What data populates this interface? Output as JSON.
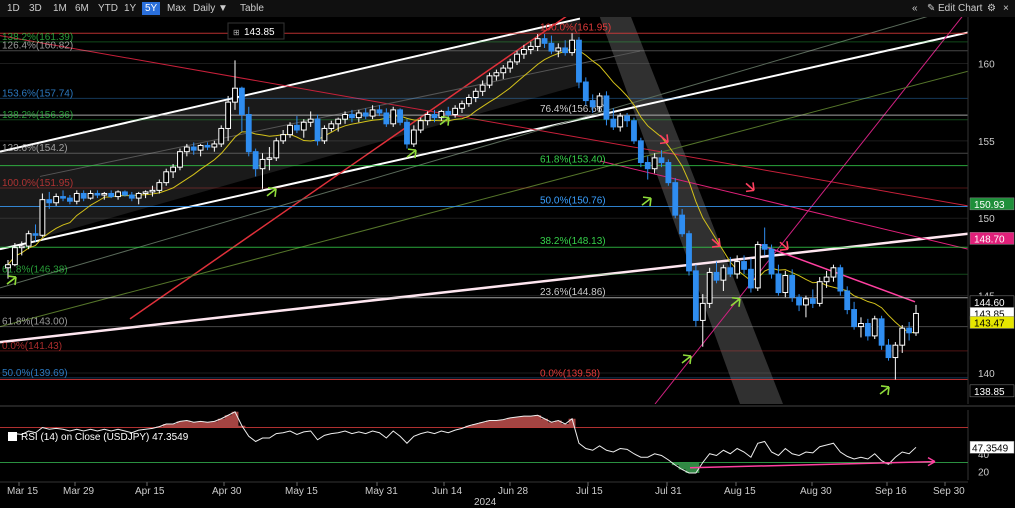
{
  "toolbar": {
    "ranges": [
      "1D",
      "3D",
      "1M",
      "6M",
      "YTD",
      "1Y",
      "5Y",
      "Max"
    ],
    "active_range": "5Y",
    "interval": "Daily ▼",
    "table_label": "Table",
    "collapse_icon": "«",
    "edit_label": "Edit Chart",
    "edit_icon": "pencil-icon",
    "gear_icon": "gear-icon"
  },
  "cursor_readout": "143.85",
  "chart_data": {
    "type": "candlestick",
    "ylim": [
      138,
      163
    ],
    "yticks": [
      140,
      145,
      150,
      155,
      160
    ],
    "x_ticks": [
      "Mar 15",
      "Mar 29",
      "Apr 15",
      "Apr 30",
      "May 15",
      "May 31",
      "Jun 14",
      "Jun 28",
      "Jul 15",
      "Jul 31",
      "Aug 15",
      "Aug 30",
      "Sep 16",
      "Sep 30"
    ],
    "x_year_label": "2024",
    "fib_levels": [
      {
        "label": "100.0%(161.95)",
        "value": 161.95,
        "color": "#e33b3b"
      },
      {
        "label": "76.4%(156.66)",
        "value": 156.66,
        "color": "#cccccc"
      },
      {
        "label": "61.8%(153.40)",
        "value": 153.4,
        "color": "#35d04a"
      },
      {
        "label": "50.0%(150.76)",
        "value": 150.76,
        "color": "#3aa0ff"
      },
      {
        "label": "38.2%(148.13)",
        "value": 148.13,
        "color": "#35d04a"
      },
      {
        "label": "23.6%(144.86)",
        "value": 144.86,
        "color": "#cccccc"
      },
      {
        "label": "0.0%(139.58)",
        "value": 139.58,
        "color": "#e33b3b"
      }
    ],
    "left_fib_labels": [
      {
        "label": "138.2%(161.39)",
        "value": 161.39,
        "color": "#35d04a"
      },
      {
        "label": "126.4%(160.82)",
        "value": 160.82,
        "color": "#cccccc"
      },
      {
        "label": "153.6%(157.74)",
        "value": 157.74,
        "color": "#3aa0ff"
      },
      {
        "label": "138.2%(156.36)",
        "value": 156.36,
        "color": "#35d04a"
      },
      {
        "label": "123.6%(154.2)",
        "value": 154.2,
        "color": "#cccccc"
      },
      {
        "label": "100.0%(151.95)",
        "value": 151.95,
        "color": "#e33b3b"
      },
      {
        "label": "61.8%(146.38)",
        "value": 146.38,
        "color": "#35d04a"
      },
      {
        "label": "61.8%(143.00)",
        "value": 143.0,
        "color": "#cccccc"
      },
      {
        "label": "0.0%(141.43)",
        "value": 141.43,
        "color": "#e33b3b"
      },
      {
        "label": "50.0%(139.69)",
        "value": 139.69,
        "color": "#3aa0ff"
      }
    ],
    "price_tags": [
      {
        "label": "150.93",
        "value": 150.93,
        "bg": "#1f8f3a",
        "fg": "#ffffff"
      },
      {
        "label": "148.70",
        "value": 148.7,
        "bg": "#e0207a",
        "fg": "#ffffff"
      },
      {
        "label": "144.60",
        "value": 144.6,
        "bg": "#000000",
        "fg": "#ffffff"
      },
      {
        "label": "143.85",
        "value": 143.85,
        "bg": "#ffffff",
        "fg": "#000000"
      },
      {
        "label": "143.47",
        "value": 143.47,
        "bg": "#e6e600",
        "fg": "#000000"
      },
      {
        "label": "138.85",
        "value": 138.85,
        "bg": "#000000",
        "fg": "#ffffff"
      }
    ],
    "candles": [
      [
        146.8,
        147.3,
        146.1,
        147.0
      ],
      [
        147.0,
        148.4,
        146.9,
        148.1
      ],
      [
        148.1,
        148.5,
        147.6,
        148.2
      ],
      [
        148.2,
        149.2,
        148.0,
        149.0
      ],
      [
        149.0,
        149.6,
        148.5,
        148.9
      ],
      [
        148.9,
        151.6,
        148.8,
        151.2
      ],
      [
        151.2,
        151.7,
        150.6,
        151.0
      ],
      [
        151.0,
        151.6,
        150.8,
        151.4
      ],
      [
        151.4,
        151.8,
        151.1,
        151.3
      ],
      [
        151.3,
        151.5,
        150.9,
        151.1
      ],
      [
        151.1,
        151.8,
        150.9,
        151.6
      ],
      [
        151.6,
        151.8,
        151.1,
        151.3
      ],
      [
        151.3,
        151.8,
        151.2,
        151.6
      ],
      [
        151.6,
        151.8,
        151.3,
        151.5
      ],
      [
        151.5,
        151.7,
        151.2,
        151.6
      ],
      [
        151.6,
        151.8,
        151.3,
        151.4
      ],
      [
        151.4,
        151.8,
        151.2,
        151.7
      ],
      [
        151.7,
        151.8,
        151.4,
        151.5
      ],
      [
        151.5,
        151.7,
        151.1,
        151.3
      ],
      [
        151.3,
        151.7,
        150.9,
        151.6
      ],
      [
        151.6,
        151.8,
        151.3,
        151.7
      ],
      [
        151.7,
        152.1,
        151.4,
        151.8
      ],
      [
        151.8,
        152.5,
        151.6,
        152.3
      ],
      [
        152.3,
        153.2,
        152.1,
        153.0
      ],
      [
        153.0,
        153.5,
        152.6,
        153.3
      ],
      [
        153.3,
        154.5,
        153.1,
        154.3
      ],
      [
        154.3,
        154.8,
        154.0,
        154.6
      ],
      [
        154.6,
        154.9,
        154.1,
        154.4
      ],
      [
        154.4,
        154.8,
        154.0,
        154.7
      ],
      [
        154.7,
        154.9,
        154.4,
        154.6
      ],
      [
        154.6,
        155.0,
        154.3,
        154.8
      ],
      [
        154.8,
        156.0,
        154.6,
        155.8
      ],
      [
        155.8,
        157.9,
        155.0,
        157.5
      ],
      [
        157.5,
        160.2,
        157.0,
        158.4
      ],
      [
        158.4,
        158.5,
        155.6,
        156.7
      ],
      [
        156.7,
        157.2,
        154.0,
        154.3
      ],
      [
        154.3,
        154.5,
        152.7,
        153.2
      ],
      [
        153.2,
        154.2,
        151.9,
        153.8
      ],
      [
        153.8,
        154.6,
        153.1,
        153.9
      ],
      [
        153.9,
        155.2,
        153.7,
        155.0
      ],
      [
        155.0,
        155.7,
        154.8,
        155.4
      ],
      [
        155.4,
        156.2,
        155.2,
        156.0
      ],
      [
        156.0,
        156.6,
        155.5,
        155.7
      ],
      [
        155.7,
        156.4,
        155.2,
        156.2
      ],
      [
        156.2,
        156.9,
        155.9,
        156.4
      ],
      [
        156.4,
        156.7,
        154.7,
        155.0
      ],
      [
        155.0,
        156.0,
        154.8,
        155.8
      ],
      [
        155.8,
        156.3,
        155.6,
        156.1
      ],
      [
        156.1,
        156.5,
        155.6,
        156.4
      ],
      [
        156.4,
        156.9,
        156.1,
        156.7
      ],
      [
        156.7,
        157.0,
        156.2,
        156.5
      ],
      [
        156.5,
        157.0,
        156.2,
        156.8
      ],
      [
        156.8,
        157.1,
        156.4,
        156.6
      ],
      [
        156.6,
        157.3,
        156.4,
        157.0
      ],
      [
        157.0,
        157.3,
        156.6,
        156.8
      ],
      [
        156.8,
        157.1,
        155.9,
        156.1
      ],
      [
        156.1,
        157.2,
        155.9,
        157.0
      ],
      [
        157.0,
        157.1,
        156.0,
        156.2
      ],
      [
        156.2,
        156.4,
        154.5,
        154.8
      ],
      [
        154.8,
        156.0,
        154.6,
        155.7
      ],
      [
        155.7,
        156.5,
        155.5,
        156.3
      ],
      [
        156.3,
        156.9,
        156.0,
        156.7
      ],
      [
        156.7,
        157.0,
        156.2,
        156.5
      ],
      [
        156.5,
        157.0,
        156.3,
        156.9
      ],
      [
        156.9,
        157.2,
        156.4,
        156.7
      ],
      [
        156.7,
        157.3,
        156.5,
        157.1
      ],
      [
        157.1,
        157.6,
        156.8,
        157.4
      ],
      [
        157.4,
        158.0,
        157.2,
        157.8
      ],
      [
        157.8,
        158.4,
        157.5,
        158.2
      ],
      [
        158.2,
        158.9,
        157.9,
        158.6
      ],
      [
        158.6,
        159.4,
        158.4,
        159.2
      ],
      [
        159.2,
        159.6,
        158.9,
        159.4
      ],
      [
        159.4,
        159.9,
        159.0,
        159.7
      ],
      [
        159.7,
        160.3,
        159.4,
        160.1
      ],
      [
        160.1,
        160.8,
        159.9,
        160.6
      ],
      [
        160.6,
        161.2,
        160.3,
        160.9
      ],
      [
        160.9,
        161.4,
        160.6,
        161.1
      ],
      [
        161.1,
        161.9,
        160.8,
        161.6
      ],
      [
        161.6,
        161.9,
        161.0,
        161.3
      ],
      [
        161.3,
        161.8,
        160.6,
        160.8
      ],
      [
        160.8,
        161.3,
        160.4,
        161.0
      ],
      [
        161.0,
        161.5,
        160.5,
        160.7
      ],
      [
        160.7,
        161.95,
        160.5,
        161.5
      ],
      [
        161.5,
        161.7,
        158.4,
        158.8
      ],
      [
        158.8,
        159.1,
        157.3,
        157.6
      ],
      [
        157.6,
        158.0,
        156.8,
        157.2
      ],
      [
        157.2,
        158.1,
        156.9,
        157.9
      ],
      [
        157.9,
        158.2,
        156.0,
        156.4
      ],
      [
        156.4,
        157.1,
        155.7,
        155.9
      ],
      [
        155.9,
        156.8,
        155.6,
        156.6
      ],
      [
        156.6,
        156.8,
        155.9,
        156.3
      ],
      [
        156.3,
        156.5,
        154.8,
        155.0
      ],
      [
        155.0,
        155.2,
        153.3,
        153.6
      ],
      [
        153.6,
        154.0,
        152.5,
        153.2
      ],
      [
        153.2,
        154.2,
        152.9,
        153.9
      ],
      [
        153.9,
        154.4,
        153.3,
        153.6
      ],
      [
        153.6,
        153.8,
        152.1,
        152.3
      ],
      [
        152.3,
        152.6,
        150.0,
        150.2
      ],
      [
        150.2,
        150.6,
        148.8,
        149.0
      ],
      [
        149.0,
        149.2,
        146.3,
        146.6
      ],
      [
        146.6,
        147.0,
        143.0,
        143.4
      ],
      [
        143.4,
        145.1,
        141.7,
        144.5
      ],
      [
        144.5,
        146.8,
        144.2,
        146.5
      ],
      [
        146.5,
        147.2,
        145.8,
        146.0
      ],
      [
        146.0,
        147.0,
        145.3,
        146.8
      ],
      [
        146.8,
        147.5,
        146.2,
        146.4
      ],
      [
        146.4,
        147.6,
        146.1,
        147.2
      ],
      [
        147.2,
        147.6,
        146.4,
        146.7
      ],
      [
        146.7,
        147.4,
        145.2,
        145.5
      ],
      [
        145.5,
        148.5,
        145.3,
        148.3
      ],
      [
        148.3,
        149.4,
        147.6,
        148.0
      ],
      [
        148.0,
        148.3,
        146.1,
        146.4
      ],
      [
        146.4,
        147.0,
        145.0,
        145.2
      ],
      [
        145.2,
        146.6,
        144.9,
        146.3
      ],
      [
        146.3,
        146.7,
        144.6,
        144.9
      ],
      [
        144.9,
        145.1,
        144.0,
        144.4
      ],
      [
        144.4,
        145.0,
        143.6,
        144.8
      ],
      [
        144.8,
        145.4,
        144.2,
        144.5
      ],
      [
        144.5,
        146.2,
        144.3,
        145.9
      ],
      [
        145.9,
        146.6,
        145.5,
        146.2
      ],
      [
        146.2,
        147.0,
        145.9,
        146.8
      ],
      [
        146.8,
        147.0,
        145.0,
        145.3
      ],
      [
        145.3,
        145.6,
        143.8,
        144.1
      ],
      [
        144.1,
        144.6,
        142.8,
        143.0
      ],
      [
        143.0,
        143.6,
        142.3,
        143.2
      ],
      [
        143.2,
        143.5,
        142.1,
        142.4
      ],
      [
        142.4,
        143.7,
        142.2,
        143.5
      ],
      [
        143.5,
        143.7,
        141.5,
        141.8
      ],
      [
        141.8,
        142.2,
        140.8,
        141.0
      ],
      [
        141.0,
        142.0,
        139.58,
        141.8
      ],
      [
        141.8,
        143.1,
        141.3,
        142.9
      ],
      [
        142.9,
        143.3,
        142.1,
        142.6
      ],
      [
        142.6,
        144.4,
        142.4,
        143.85
      ]
    ],
    "indicator": {
      "name": "RSI (14)",
      "legend": "RSI (14)   on Close (USDJPY) 47.3549",
      "value_label": "47.3549",
      "ylim": [
        10,
        90
      ],
      "yticks": [
        20,
        40
      ],
      "levels": [
        70,
        30
      ],
      "values": [
        60,
        63,
        62,
        66,
        64,
        70,
        68,
        69,
        68,
        66,
        68,
        66,
        68,
        66,
        68,
        66,
        68,
        66,
        64,
        67,
        68,
        69,
        71,
        74,
        74,
        77,
        78,
        76,
        77,
        76,
        77,
        80,
        84,
        88,
        72,
        60,
        54,
        58,
        58,
        63,
        64,
        66,
        62,
        65,
        66,
        56,
        61,
        63,
        64,
        66,
        63,
        65,
        63,
        66,
        64,
        58,
        66,
        60,
        52,
        60,
        63,
        65,
        63,
        66,
        64,
        67,
        69,
        72,
        74,
        76,
        78,
        78,
        79,
        81,
        82,
        83,
        83,
        84,
        80,
        76,
        78,
        74,
        80,
        52,
        46,
        44,
        49,
        44,
        42,
        46,
        45,
        40,
        36,
        36,
        40,
        38,
        33,
        27,
        22,
        18,
        18,
        30,
        40,
        38,
        44,
        40,
        46,
        42,
        36,
        52,
        54,
        42,
        38,
        46,
        40,
        38,
        42,
        41,
        48,
        50,
        52,
        42,
        37,
        34,
        36,
        34,
        40,
        32,
        28,
        36,
        42,
        40,
        47.35
      ]
    }
  }
}
